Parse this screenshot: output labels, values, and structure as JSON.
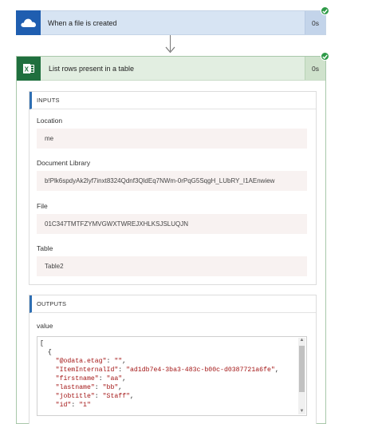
{
  "trigger": {
    "title": "When a file is created",
    "duration": "0s",
    "icon": "onedrive-cloud-icon",
    "status": "succeeded"
  },
  "action": {
    "title": "List rows present in a table",
    "duration": "0s",
    "icon": "excel-icon",
    "status": "succeeded",
    "inputs": {
      "header": "INPUTS",
      "location_label": "Location",
      "location_value": "me",
      "library_label": "Document Library",
      "library_value": "b!Plk6spdyAk2lyf7inxt8324Qdnf3QldEq7NWm-0rPqG5SqgH_LUbRY_I1AEnwiew",
      "file_label": "File",
      "file_value": "01C347TMTFZYMVGWXTWREJXHLKSJSLUQJN",
      "table_label": "Table",
      "table_value": "Table2"
    },
    "outputs": {
      "header": "OUTPUTS",
      "value_label": "value",
      "json_lines": [
        "[",
        "  {",
        "    \"@odata.etag\": \"\",",
        "    \"ItemInternalId\": \"ad1db7e4-3ba3-483c-b00c-d0387721a6fe\",",
        "    \"firstname\": \"aa\",",
        "    \"lastname\": \"bb\",",
        "    \"jobtitle\": \"Staff\",",
        "    \"id\": \"1\""
      ]
    }
  },
  "colors": {
    "trigger_accent": "#1f5eb0",
    "excel_accent": "#1f6f3e",
    "success": "#2e9a48",
    "panel_accent": "#2f6fb3"
  }
}
